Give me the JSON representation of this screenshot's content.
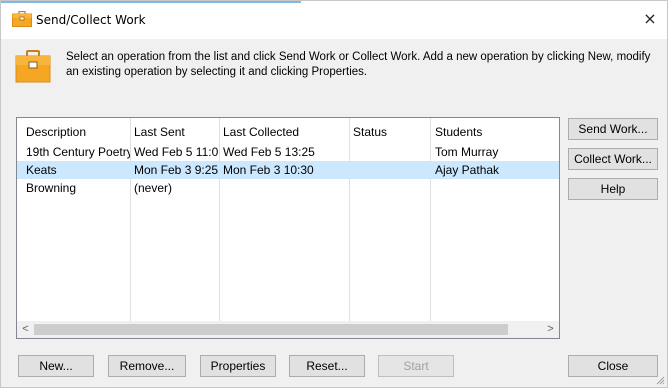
{
  "window": {
    "title": "Send/Collect Work",
    "close_glyph": "×"
  },
  "info": {
    "text": "Select an operation from the list and click Send Work or Collect Work. Add a new operation by clicking New, modify an existing operation by selecting it and clicking Properties.",
    "icon": "briefcase-icon"
  },
  "list": {
    "columns": [
      "Description",
      "Last Sent",
      "Last Collected",
      "Status",
      "Students"
    ],
    "rows": [
      {
        "description": "19th Century Poetry",
        "last_sent": "Wed Feb 5 11:0",
        "last_collected": "Wed Feb 5 13:25",
        "status": "",
        "students": "Tom Murray"
      },
      {
        "description": "Keats",
        "last_sent": "Mon Feb 3 9:25",
        "last_collected": "Mon Feb 3 10:30",
        "status": "",
        "students": "Ajay Pathak"
      },
      {
        "description": "Browning",
        "last_sent": "(never)",
        "last_collected": "",
        "status": "",
        "students": ""
      }
    ],
    "selected_row": 1,
    "scroll_left": "<",
    "scroll_right": ">"
  },
  "side_buttons": {
    "send": "Send Work...",
    "collect": "Collect Work...",
    "help": "Help"
  },
  "bottom_buttons": {
    "new": "New...",
    "remove": "Remove...",
    "properties": "Properties",
    "reset": "Reset...",
    "start": "Start",
    "close": "Close"
  },
  "colors": {
    "selection": "#cce8ff",
    "icon_orange": "#f5a623"
  }
}
